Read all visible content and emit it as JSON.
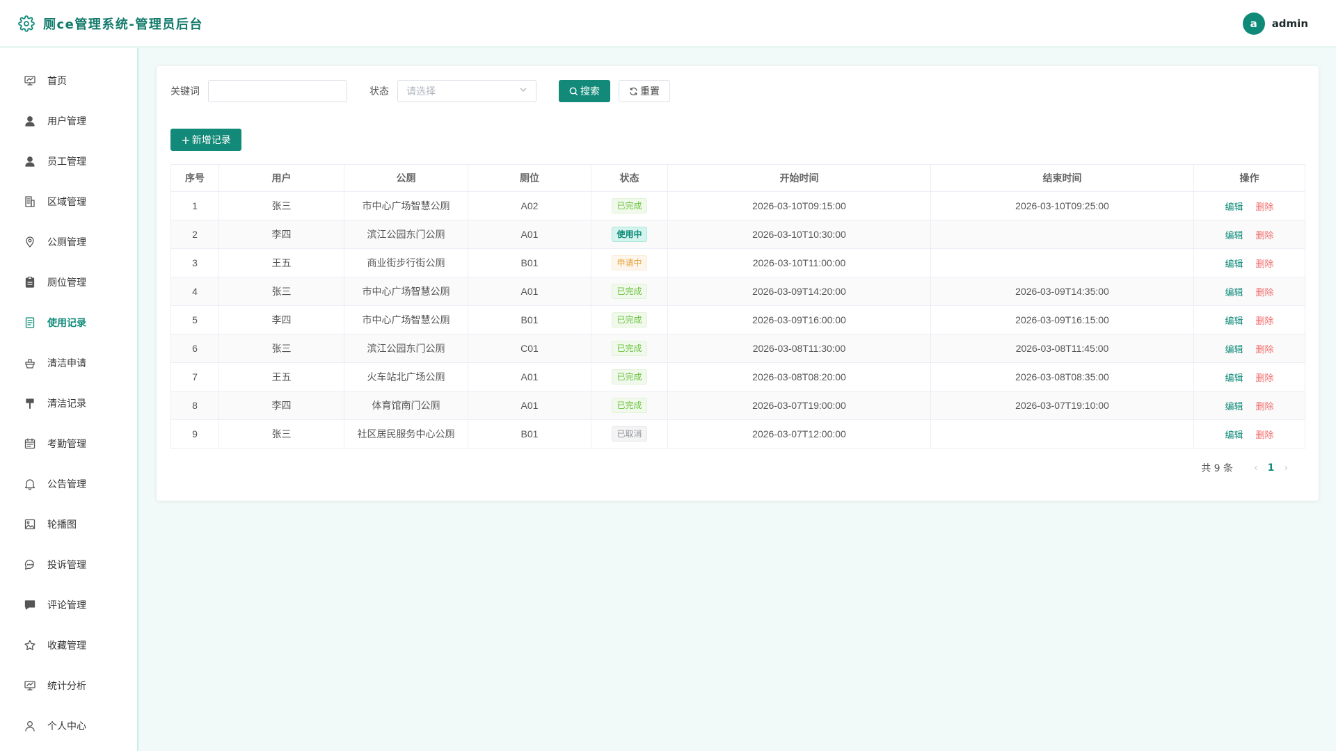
{
  "app": {
    "title": "厕ce管理系统-管理员后台"
  },
  "user": {
    "avatar_letter": "a",
    "name": "admin"
  },
  "sidebar": {
    "items": [
      {
        "label": "首页",
        "icon": "dashboard-icon"
      },
      {
        "label": "用户管理",
        "icon": "user-icon"
      },
      {
        "label": "员工管理",
        "icon": "staff-icon"
      },
      {
        "label": "区域管理",
        "icon": "building-icon"
      },
      {
        "label": "公厕管理",
        "icon": "location-icon"
      },
      {
        "label": "厕位管理",
        "icon": "clipboard-icon"
      },
      {
        "label": "使用记录",
        "icon": "document-icon",
        "active": true
      },
      {
        "label": "清洁申请",
        "icon": "brush-icon"
      },
      {
        "label": "清洁记录",
        "icon": "toilet-brush-icon"
      },
      {
        "label": "考勤管理",
        "icon": "calendar-icon"
      },
      {
        "label": "公告管理",
        "icon": "bell-icon"
      },
      {
        "label": "轮播图",
        "icon": "picture-icon"
      },
      {
        "label": "投诉管理",
        "icon": "chat-icon"
      },
      {
        "label": "评论管理",
        "icon": "comment-icon"
      },
      {
        "label": "收藏管理",
        "icon": "star-icon"
      },
      {
        "label": "统计分析",
        "icon": "chart-icon"
      },
      {
        "label": "个人中心",
        "icon": "profile-icon"
      }
    ]
  },
  "filter": {
    "keyword_label": "关键词",
    "keyword_value": "",
    "status_label": "状态",
    "status_placeholder": "请选择",
    "search_label": "搜索",
    "reset_label": "重置"
  },
  "toolbar": {
    "add_label": "新增记录"
  },
  "table": {
    "columns": [
      "序号",
      "用户",
      "公厕",
      "厕位",
      "状态",
      "开始时间",
      "结束时间",
      "操作"
    ],
    "edit_label": "编辑",
    "delete_label": "删除",
    "rows": [
      {
        "no": "1",
        "user": "张三",
        "toilet": "市中心广场智慧公厕",
        "stall": "A02",
        "status": "已完成",
        "status_type": "success",
        "start": "2026-03-10T09:15:00",
        "end": "2026-03-10T09:25:00"
      },
      {
        "no": "2",
        "user": "李四",
        "toilet": "滨江公园东门公厕",
        "stall": "A01",
        "status": "使用中",
        "status_type": "active",
        "start": "2026-03-10T10:30:00",
        "end": ""
      },
      {
        "no": "3",
        "user": "王五",
        "toilet": "商业街步行街公厕",
        "stall": "B01",
        "status": "申请中",
        "status_type": "warning",
        "start": "2026-03-10T11:00:00",
        "end": ""
      },
      {
        "no": "4",
        "user": "张三",
        "toilet": "市中心广场智慧公厕",
        "stall": "A01",
        "status": "已完成",
        "status_type": "success",
        "start": "2026-03-09T14:20:00",
        "end": "2026-03-09T14:35:00"
      },
      {
        "no": "5",
        "user": "李四",
        "toilet": "市中心广场智慧公厕",
        "stall": "B01",
        "status": "已完成",
        "status_type": "success",
        "start": "2026-03-09T16:00:00",
        "end": "2026-03-09T16:15:00"
      },
      {
        "no": "6",
        "user": "张三",
        "toilet": "滨江公园东门公厕",
        "stall": "C01",
        "status": "已完成",
        "status_type": "success",
        "start": "2026-03-08T11:30:00",
        "end": "2026-03-08T11:45:00"
      },
      {
        "no": "7",
        "user": "王五",
        "toilet": "火车站北广场公厕",
        "stall": "A01",
        "status": "已完成",
        "status_type": "success",
        "start": "2026-03-08T08:20:00",
        "end": "2026-03-08T08:35:00"
      },
      {
        "no": "8",
        "user": "李四",
        "toilet": "体育馆南门公厕",
        "stall": "A01",
        "status": "已完成",
        "status_type": "success",
        "start": "2026-03-07T19:00:00",
        "end": "2026-03-07T19:10:00"
      },
      {
        "no": "9",
        "user": "张三",
        "toilet": "社区居民服务中心公厕",
        "stall": "B01",
        "status": "已取消",
        "status_type": "info",
        "start": "2026-03-07T12:00:00",
        "end": ""
      }
    ]
  },
  "pagination": {
    "total_text": "共 9 条",
    "current_page": "1"
  },
  "colors": {
    "primary": "#138a79",
    "danger": "#f36c6c",
    "success_text": "#67c23a",
    "success_bg": "#f0f9eb",
    "success_border": "#e1f3d8",
    "active_text": "#0f8a79",
    "active_bg": "#d4f4ee",
    "active_border": "#a8e6da",
    "warning_text": "#e6a23c",
    "warning_bg": "#fdf6ec",
    "warning_border": "#faecd8",
    "info_text": "#909399",
    "info_bg": "#f4f4f5",
    "info_border": "#e9e9eb"
  }
}
